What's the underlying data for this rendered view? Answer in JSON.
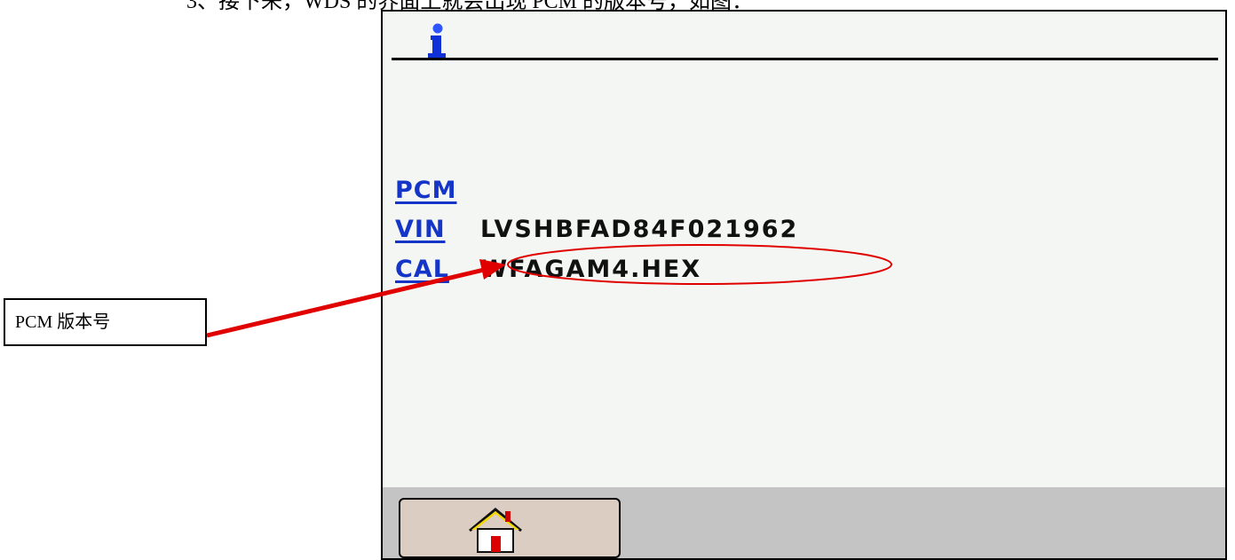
{
  "document": {
    "caption": "3、接下来，WDS 的界面上就会出现 PCM 的版本号，如图：",
    "annotation": "PCM 版本号"
  },
  "screen": {
    "icons": {
      "header": "info-icon",
      "footer": "home-icon"
    },
    "rows": {
      "pcm": {
        "label": "PCM",
        "value": ""
      },
      "vin": {
        "label": "VIN",
        "value": "LVSHBFAD84F021962"
      },
      "cal": {
        "label": "CAL",
        "value": "WFAGAM4.HEX"
      }
    }
  },
  "colors": {
    "screen_background": "#f3f6f2",
    "label_blue": "#1535c9",
    "footer_gray": "#c4c4c4",
    "button_fill": "#dccdc2",
    "annotation_red": "#e00000"
  }
}
